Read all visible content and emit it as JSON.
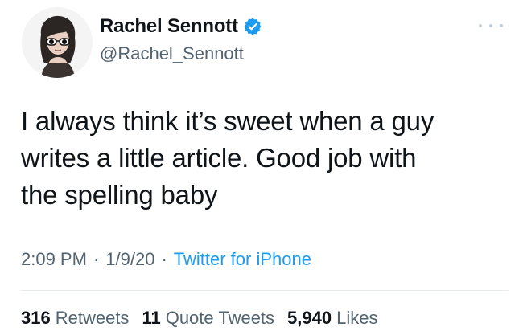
{
  "user": {
    "display_name": "Rachel Sennott",
    "handle": "@Rachel_Sennott",
    "verified": true
  },
  "tweet": {
    "text_lines": [
      "I always think it’s sweet when a guy",
      "writes a little article. Good job with",
      "the spelling baby"
    ],
    "time": "2:09 PM",
    "date": "1/9/20",
    "source": "Twitter for iPhone",
    "separator": "·"
  },
  "stats": {
    "retweets": {
      "count": "316",
      "label": "Retweets"
    },
    "quote_tweets": {
      "count": "11",
      "label": "Quote Tweets"
    },
    "likes": {
      "count": "5,940",
      "label": "Likes"
    }
  },
  "icons": {
    "verified": "verified-badge-icon",
    "more": "more-options-icon"
  },
  "colors": {
    "text": "#0f1419",
    "secondary_text": "#536471",
    "link": "#1d9bf0",
    "verified": "#1d9bf0"
  }
}
